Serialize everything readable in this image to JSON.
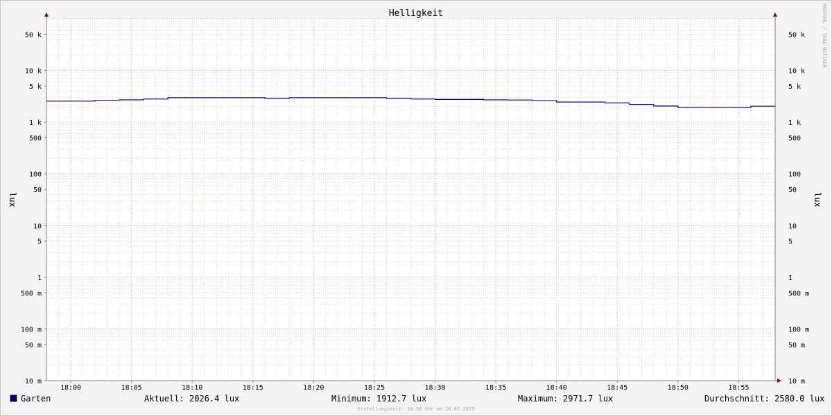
{
  "chart_data": {
    "type": "line",
    "title": "Helligkeit",
    "ylabel": "lux",
    "yscale": "log",
    "ylim": [
      0.01,
      100000
    ],
    "xlim_minutes": [
      "17:58",
      "17:58 + 60 min"
    ],
    "x_ticks": [
      "18:00",
      "18:05",
      "18:10",
      "18:15",
      "18:20",
      "18:25",
      "18:30",
      "18:35",
      "18:40",
      "18:45",
      "18:50",
      "18:55"
    ],
    "y_ticks": [
      {
        "value": 50000,
        "label": "50 k"
      },
      {
        "value": 10000,
        "label": "10 k"
      },
      {
        "value": 5000,
        "label": "5 k"
      },
      {
        "value": 1000,
        "label": "1 k"
      },
      {
        "value": 500,
        "label": "500"
      },
      {
        "value": 100,
        "label": "100"
      },
      {
        "value": 50,
        "label": "50"
      },
      {
        "value": 10,
        "label": "10"
      },
      {
        "value": 5,
        "label": "5"
      },
      {
        "value": 1,
        "label": "1"
      },
      {
        "value": 0.5,
        "label": "500 m"
      },
      {
        "value": 0.1,
        "label": "100 m"
      },
      {
        "value": 0.05,
        "label": "50 m"
      },
      {
        "value": 0.01,
        "label": "10 m"
      }
    ],
    "grid": true,
    "series": [
      {
        "name": "Garten",
        "color": "#000080",
        "step": true,
        "x": [
          "17:58",
          "18:00",
          "18:02",
          "18:04",
          "18:06",
          "18:08",
          "18:10",
          "18:12",
          "18:14",
          "18:16",
          "18:18",
          "18:20",
          "18:22",
          "18:24",
          "18:26",
          "18:28",
          "18:30",
          "18:32",
          "18:34",
          "18:36",
          "18:38",
          "18:40",
          "18:42",
          "18:44",
          "18:46",
          "18:48",
          "18:50",
          "18:52",
          "18:54",
          "18:56",
          "18:58"
        ],
        "values": [
          2550,
          2550,
          2650,
          2700,
          2800,
          2970,
          2970,
          2970,
          2970,
          2880,
          2970,
          2970,
          2970,
          2970,
          2880,
          2800,
          2750,
          2750,
          2700,
          2680,
          2600,
          2450,
          2450,
          2350,
          2200,
          2050,
          1910,
          1910,
          1910,
          2030,
          2030
        ]
      }
    ],
    "legend": {
      "position": "bottom",
      "swatch_color": "#000080",
      "series_name": "Garten",
      "stats": [
        {
          "label": "Aktuell:",
          "value": "2026.4 lux"
        },
        {
          "label": "Minimum:",
          "value": "1912.7 lux"
        },
        {
          "label": "Maximum:",
          "value": "2971.7 lux"
        },
        {
          "label": "Durchschnitt:",
          "value": "2580.0 lux"
        }
      ]
    },
    "colors": {
      "background": "#f3f3f3",
      "plot_background": "#ffffff",
      "major_grid": "#e8a0a0",
      "minor_grid": "#c8c8c8",
      "axis": "#808080",
      "arrow": "#800000"
    }
  },
  "watermark": "RRDTOOL / TOBI OETIKER",
  "footer": "Erstellungszeit: 18:58 Uhr am 26.07.2025"
}
